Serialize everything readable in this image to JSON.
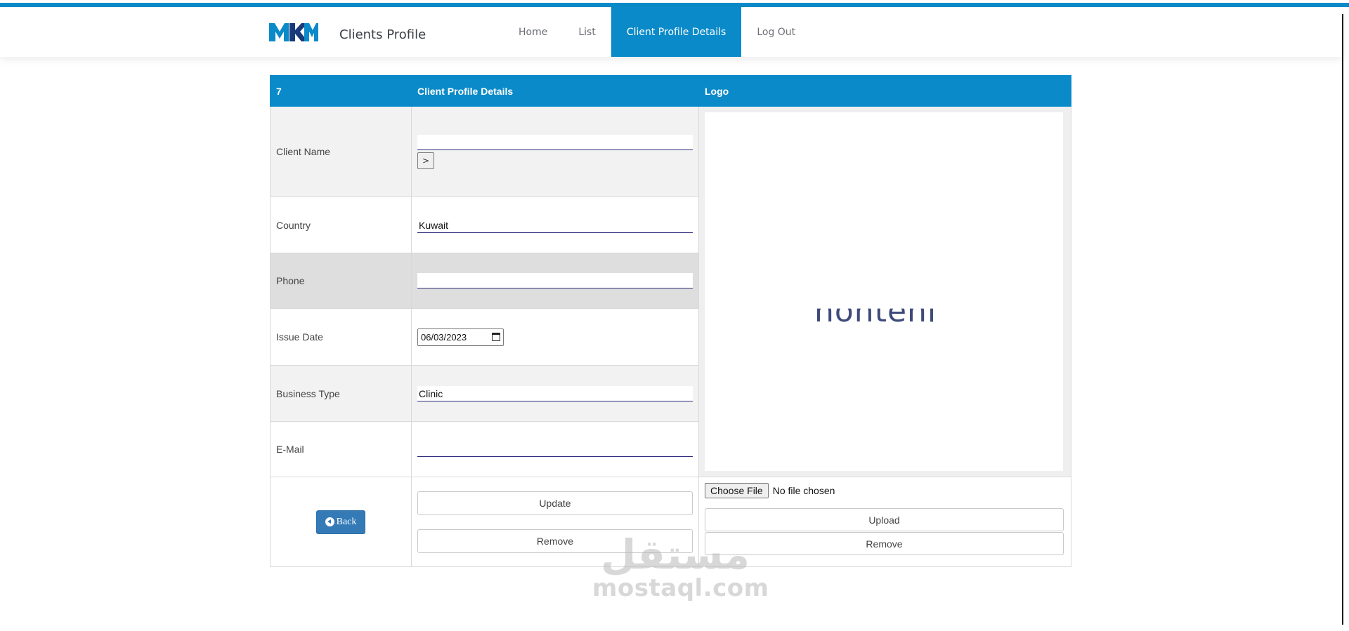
{
  "app": {
    "brand_logo_text": "MKM",
    "brand_title": "Clients Profile",
    "accent_color": "#0a8ac8"
  },
  "nav": {
    "items": [
      {
        "label": "Home",
        "active": false
      },
      {
        "label": "List",
        "active": false
      },
      {
        "label": "Client Profile Details",
        "active": true
      },
      {
        "label": "Log Out",
        "active": false
      }
    ]
  },
  "table": {
    "headers": {
      "id": "7",
      "details": "Client Profile Details",
      "logo": "Logo"
    },
    "fields": {
      "client_name": {
        "label": "Client Name",
        "value": "",
        "go_label": ">"
      },
      "country": {
        "label": "Country",
        "value": "Kuwait"
      },
      "phone": {
        "label": "Phone",
        "value": ""
      },
      "issue_date": {
        "label": "Issue Date",
        "value": "06/03/2023"
      },
      "business_type": {
        "label": "Business Type",
        "value": "Clinic"
      },
      "email": {
        "label": "E-Mail",
        "value": ""
      }
    },
    "logo_preview_text": "nonteni"
  },
  "actions": {
    "back_label": "Back",
    "update_label": "Update",
    "remove_label": "Remove",
    "choose_file_label": "Choose File",
    "file_status": "No file chosen",
    "upload_label": "Upload",
    "remove_logo_label": "Remove"
  },
  "watermark": {
    "arabic": "مستقل",
    "latin": "mostaql.com"
  }
}
